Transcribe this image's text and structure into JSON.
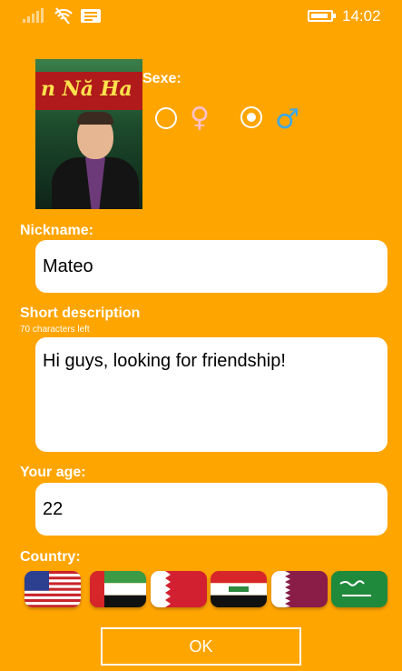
{
  "status_bar": {
    "time": "14:02",
    "icons": [
      "signal-icon",
      "wifi-icon",
      "message-icon",
      "battery-icon"
    ]
  },
  "profile": {
    "photo_icon": "profile-photo"
  },
  "sexe": {
    "label": "Sexe:",
    "options": [
      {
        "symbol": "♀",
        "selected": false,
        "color": "#FFC0CB"
      },
      {
        "symbol": "♂",
        "selected": true,
        "color": "#3AA8E8"
      }
    ]
  },
  "nickname": {
    "label": "Nickname:",
    "value": "Mateo"
  },
  "description": {
    "label": "Short description",
    "counter": "70  characters left",
    "value": "Hi guys, looking for friendship!"
  },
  "age": {
    "label": "Your age:",
    "value": "22"
  },
  "country": {
    "label": "Country:",
    "flags": [
      "us-flag-icon",
      "uae-flag-icon",
      "bahrain-flag-icon",
      "iraq-flag-icon",
      "qatar-flag-icon",
      "saudi-flag-icon"
    ]
  },
  "ok_button": {
    "label": "OK"
  },
  "colors": {
    "background": "#FFA500",
    "female": "#FFC0CB",
    "male": "#3AA8E8"
  }
}
